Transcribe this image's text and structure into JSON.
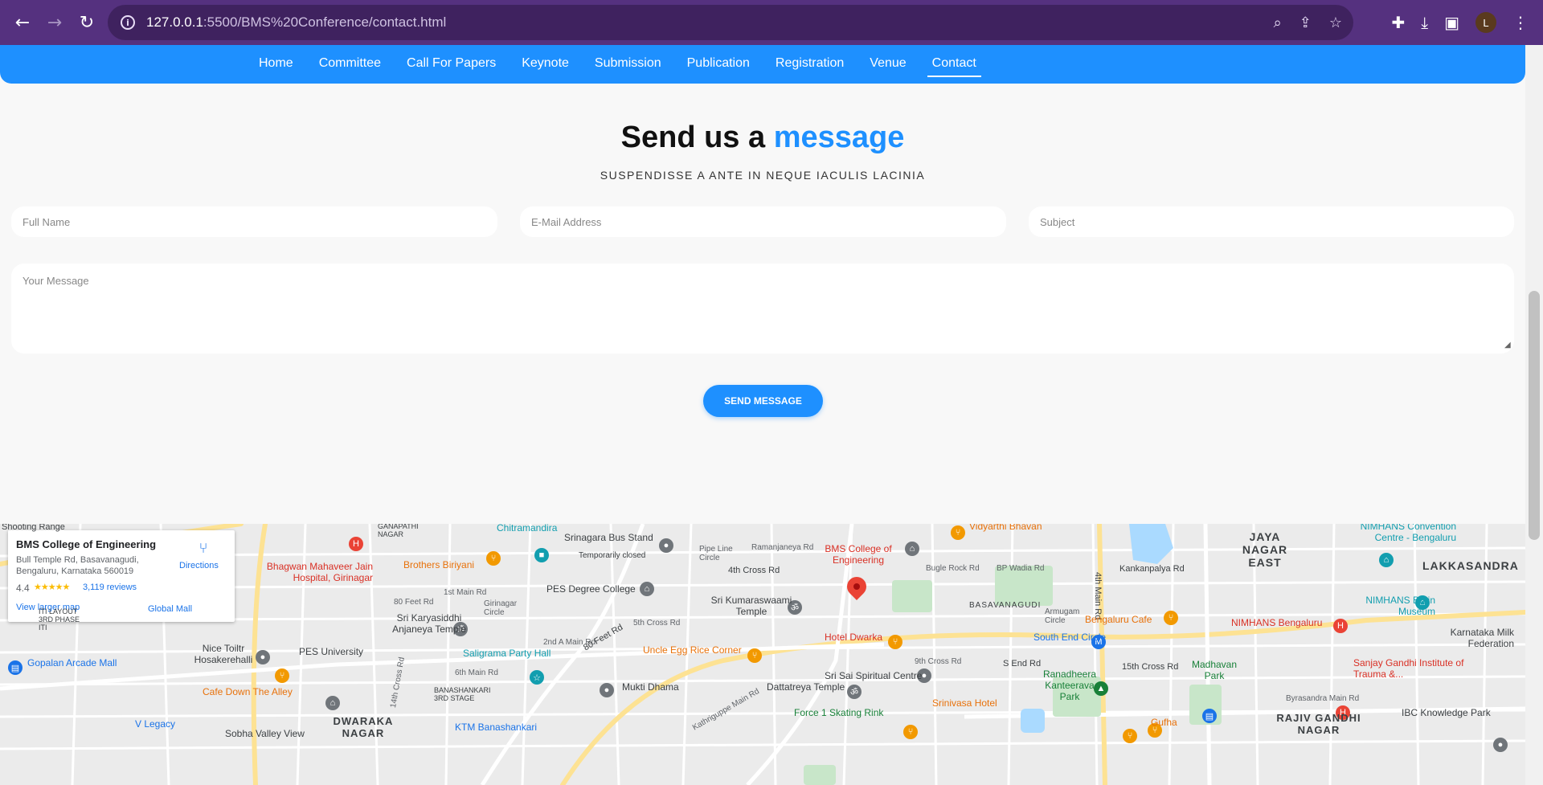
{
  "browser": {
    "url_host": "127.0.0.1",
    "url_path": ":5500/BMS%20Conference/contact.html",
    "avatar_letter": "L"
  },
  "nav": {
    "items": [
      {
        "label": "Home"
      },
      {
        "label": "Committee"
      },
      {
        "label": "Call For Papers"
      },
      {
        "label": "Keynote"
      },
      {
        "label": "Submission"
      },
      {
        "label": "Publication"
      },
      {
        "label": "Registration"
      },
      {
        "label": "Venue"
      },
      {
        "label": "Contact"
      }
    ],
    "active": "Contact"
  },
  "contact": {
    "heading_part1": "Send us a ",
    "heading_part2": "message",
    "subheading": "SUSPENDISSE A ANTE IN NEQUE IACULIS LACINIA",
    "full_name_placeholder": "Full Name",
    "email_placeholder": "E-Mail Address",
    "subject_placeholder": "Subject",
    "message_placeholder": "Your Message",
    "send_label": "SEND MESSAGE"
  },
  "map": {
    "card": {
      "title": "BMS College of Engineering",
      "address": "Bull Temple Rd, Basavanagudi, Bengaluru, Karnataka 560019",
      "rating": "4.4",
      "stars": "★★★★★",
      "reviews": "3,119 reviews",
      "directions": "Directions",
      "larger_map": "View larger map"
    },
    "labels": {
      "shooting_range": "Shooting Range",
      "ganapathi_nagar": "GANAPATHI NAGAR",
      "chitramandira": "Chitramandira",
      "srinagara_bus_stand": "Srinagara Bus Stand",
      "temporarily_closed": "Temporarily closed",
      "pipe_line_circle": "Pipe Line Circle",
      "ramanjaneya_rd": "Ramanjaneya Rd",
      "bms_college": "BMS College of Engineering",
      "vidyarthi_bhavan": "Vidyarthi Bhavan",
      "jaya_nagar_east": "JAYA NAGAR EAST",
      "nimhans_convention": "NIMHANS Convention Centre - Bengaluru",
      "lakkasandra": "LAKKASANDRA",
      "bhagwan_mahaveer": "Bhagwan Mahaveer Jain Hospital, Girinagar",
      "brothers_biriyani": "Brothers Biriyani",
      "pes_degree_college": "PES Degree College",
      "fourth_cross_rd": "4th Cross Rd",
      "bugle_rock_rd": "Bugle Rock Rd",
      "bp_wadia_rd": "BP Wadia Rd",
      "kankanpalya_rd": "Kankanpalya Rd",
      "global_mall": "Global Mall",
      "first_main_rd": "1st Main Rd",
      "eighty_feet_rd": "80 Feet Rd",
      "girinagar_circle": "Girinagar Circle",
      "sri_kumaraswaami_temple": "Sri Kumaraswaami Temple",
      "basavanagudi": "BASAVANAGUDI",
      "armugam_circle": "Armugam Circle",
      "fourth_main_rd": "4th Main Rd",
      "nimhans_brain_museum": "NIMHANS Brain Museum",
      "iti_layout": "ITI LAYOUT 3RD PHASE ITI",
      "sri_karyasiddhi": "Sri Karyasiddhi Anjaneya Temple",
      "fifth_cross_rd": "5th Cross Rd",
      "bengaluru_cafe": "Bengaluru Cafe",
      "nimhans_bengaluru": "NIMHANS Bengaluru",
      "karnataka_milk": "Karnataka Milk Federation",
      "nice_toiltr": "Nice Toiltr Hosakerehalli",
      "pes_university": "PES University",
      "saligrama_party_hall": "Saligrama Party Hall",
      "uncle_egg_rice": "Uncle Egg Rice Corner",
      "hotel_dwarka": "Hotel Dwarka",
      "south_end_circle": "South End Circle",
      "s_end_rd": "S End Rd",
      "ranadheera": "Ranadheera Kanteerava Park",
      "fifteenth_cross_rd": "15th Cross Rd",
      "madhavan_park": "Madhavan Park",
      "sanjay_gandhi": "Sanjay Gandhi Institute of Trauma &...",
      "gopalan_arcade": "Gopalan Arcade Mall",
      "cafe_down_the_alley": "Cafe Down The Alley",
      "banashankari": "BANASHANKARI 3RD STAGE",
      "mukti_dhama": "Mukti Dhama",
      "dattatreya_temple": "Dattatreya Temple",
      "sri_sai_spiritual": "Sri Sai Spiritual Centre",
      "ninth_cross_rd": "9th Cross Rd",
      "srinivasa_hotel": "Srinivasa Hotel",
      "force_1_skating": "Force 1 Skating Rink",
      "byrasandra_main_rd": "Byrasandra Main Rd",
      "v_legacy": "V Legacy",
      "sobha_valley_view": "Sobha Valley View",
      "dwaraka_nagar": "DWARAKA NAGAR",
      "ktm_banashankari": "KTM Banashankari",
      "gufha": "Gufha",
      "rajiv_gandhi_nagar": "RAJIV GANDHI NAGAR",
      "ibc_knowledge_park": "IBC Knowledge Park",
      "kathriguppe_main_rd": "Kathriguppe Main Rd",
      "second_a_main_rd": "2nd A Main Rd",
      "sixth_main_rd": "6th Main Rd",
      "fourteenth_cross_rd": "14th Cross Rd",
      "eighty_feet_rd_2": "80 Feet Rd"
    }
  }
}
